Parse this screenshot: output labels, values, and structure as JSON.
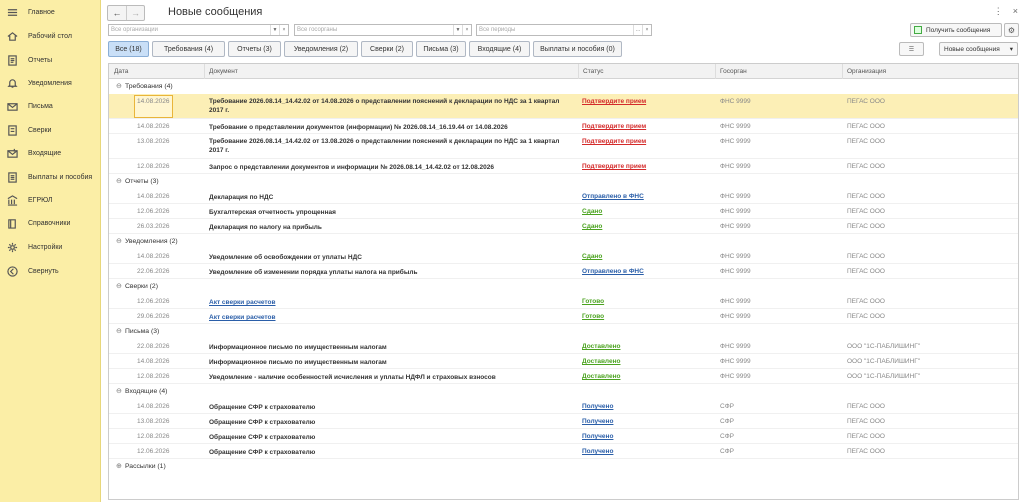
{
  "sidebar": {
    "items": [
      {
        "label": "Главное",
        "icon": "menu-icon"
      },
      {
        "label": "Рабочий стол",
        "icon": "home-icon"
      },
      {
        "label": "Отчеты",
        "icon": "reports-icon"
      },
      {
        "label": "Уведомления",
        "icon": "bell-icon"
      },
      {
        "label": "Письма",
        "icon": "mail-icon"
      },
      {
        "label": "Сверки",
        "icon": "reconcile-icon"
      },
      {
        "label": "Входящие",
        "icon": "inbox-icon"
      },
      {
        "label": "Выплаты и пособия",
        "icon": "payments-icon"
      },
      {
        "label": "ЕГРЮЛ",
        "icon": "registry-icon"
      },
      {
        "label": "Справочники",
        "icon": "book-icon"
      },
      {
        "label": "Настройки",
        "icon": "gear-icon"
      },
      {
        "label": "Свернуть",
        "icon": "collapse-icon"
      }
    ]
  },
  "header": {
    "title": "Новые сообщения",
    "back": "←",
    "forward": "→",
    "more": "⋮",
    "close": "×"
  },
  "filters": {
    "org_placeholder": "Все организации",
    "gov_placeholder": "Все госорганы",
    "period_placeholder": "Все периоды"
  },
  "toolbar": {
    "get_messages": "Получить сообщения",
    "view_select": "Новые сообщения"
  },
  "tabs": [
    "Все (18)",
    "Требования (4)",
    "Отчеты (3)",
    "Уведомления (2)",
    "Сверки (2)",
    "Письма (3)",
    "Входящие (4)",
    "Выплаты и пособия (0)"
  ],
  "columns": {
    "date": "Дата",
    "doc": "Документ",
    "status": "Статус",
    "gov": "Госорган",
    "org": "Организация"
  },
  "colors": {
    "status_red": "#d42a2a",
    "status_blue": "#2a5ea8",
    "status_green": "#4ba31f",
    "selected_row": "#fcefb6",
    "sidebar": "#fbeea6",
    "active_tab": "#c9dff7"
  },
  "groups": [
    {
      "label": "Требования (4)",
      "rows": [
        {
          "date": "14.08.2026",
          "doc": "Требование 2026.08.14_14.42.02 от 14.08.2026 о представлении пояснений к декларации по НДС за 1 квартал 2017 г.",
          "status": "Подтвердите прием",
          "status_color": "red",
          "gov": "ФНС 9999",
          "org": "ПЕГАС ООО",
          "tall": true,
          "selected": true
        },
        {
          "date": "14.08.2026",
          "doc": "Требование о представлении документов (информации) № 2026.08.14_16.19.44 от 14.08.2026",
          "status": "Подтвердите прием",
          "status_color": "red",
          "gov": "ФНС 9999",
          "org": "ПЕГАС ООО"
        },
        {
          "date": "13.08.2026",
          "doc": "Требование 2026.08.14_14.42.02 от 13.08.2026 о представлении пояснений к декларации по НДС за 1 квартал 2017 г.",
          "status": "Подтвердите прием",
          "status_color": "red",
          "gov": "ФНС 9999",
          "org": "ПЕГАС ООО",
          "tall": true
        },
        {
          "date": "12.08.2026",
          "doc": "Запрос о представлении документов и информации № 2026.08.14_14.42.02 от 12.08.2026",
          "status": "Подтвердите прием",
          "status_color": "red",
          "gov": "ФНС 9999",
          "org": "ПЕГАС ООО"
        }
      ]
    },
    {
      "label": "Отчеты (3)",
      "rows": [
        {
          "date": "14.08.2026",
          "doc": "Декларация по НДС",
          "status": "Отправлено в ФНС",
          "status_color": "blue",
          "gov": "ФНС 9999",
          "org": "ПЕГАС ООО"
        },
        {
          "date": "12.06.2026",
          "doc": "Бухгалтерская отчетность упрощенная",
          "status": "Сдано",
          "status_color": "green",
          "gov": "ФНС 9999",
          "org": "ПЕГАС ООО"
        },
        {
          "date": "26.03.2026",
          "doc": "Декларация по налогу на прибыль",
          "status": "Сдано",
          "status_color": "green",
          "gov": "ФНС 9999",
          "org": "ПЕГАС ООО"
        }
      ]
    },
    {
      "label": "Уведомления (2)",
      "rows": [
        {
          "date": "14.08.2026",
          "doc": "Уведомление об освобождении от уплаты НДС",
          "status": "Сдано",
          "status_color": "green",
          "gov": "ФНС 9999",
          "org": "ПЕГАС ООО"
        },
        {
          "date": "22.06.2026",
          "doc": "Уведомление об изменении порядка уплаты налога на прибыль",
          "status": "Отправлено в ФНС",
          "status_color": "blue",
          "gov": "ФНС 9999",
          "org": "ПЕГАС ООО"
        }
      ]
    },
    {
      "label": "Сверки (2)",
      "rows": [
        {
          "date": "12.06.2026",
          "doc": "Акт сверки расчетов",
          "status": "Готово",
          "status_color": "green",
          "gov": "ФНС 9999",
          "org": "ПЕГАС ООО",
          "link": true
        },
        {
          "date": "29.06.2026",
          "doc": "Акт сверки расчетов",
          "status": "Готово",
          "status_color": "green",
          "gov": "ФНС 9999",
          "org": "ПЕГАС ООО",
          "link": true
        }
      ]
    },
    {
      "label": "Письма (3)",
      "rows": [
        {
          "date": "22.08.2026",
          "doc": "Информационное письмо по имущественным налогам",
          "status": "Доставлено",
          "status_color": "green",
          "gov": "ФНС 9999",
          "org": "ООО \"1С-ПАБЛИШИНГ\""
        },
        {
          "date": "14.08.2026",
          "doc": "Информационное письмо по имущественным налогам",
          "status": "Доставлено",
          "status_color": "green",
          "gov": "ФНС 9999",
          "org": "ООО \"1С-ПАБЛИШИНГ\""
        },
        {
          "date": "12.08.2026",
          "doc": "Уведомление - наличие особенностей исчисления и уплаты НДФЛ и страховых взносов",
          "status": "Доставлено",
          "status_color": "green",
          "gov": "ФНС 9999",
          "org": "ООО \"1С-ПАБЛИШИНГ\""
        }
      ]
    },
    {
      "label": "Входящие (4)",
      "rows": [
        {
          "date": "14.08.2026",
          "doc": "Обращение СФР к страхователю",
          "status": "Получено",
          "status_color": "blue",
          "gov": "СФР",
          "org": "ПЕГАС ООО"
        },
        {
          "date": "13.08.2026",
          "doc": "Обращение СФР к страхователю",
          "status": "Получено",
          "status_color": "blue",
          "gov": "СФР",
          "org": "ПЕГАС ООО"
        },
        {
          "date": "12.08.2026",
          "doc": "Обращение СФР к страхователю",
          "status": "Получено",
          "status_color": "blue",
          "gov": "СФР",
          "org": "ПЕГАС ООО"
        },
        {
          "date": "12.06.2026",
          "doc": "Обращение СФР к страхователю",
          "status": "Получено",
          "status_color": "blue",
          "gov": "СФР",
          "org": "ПЕГАС ООО"
        }
      ]
    },
    {
      "label": "Рассылки (1)",
      "collapsed": true,
      "rows": []
    }
  ]
}
